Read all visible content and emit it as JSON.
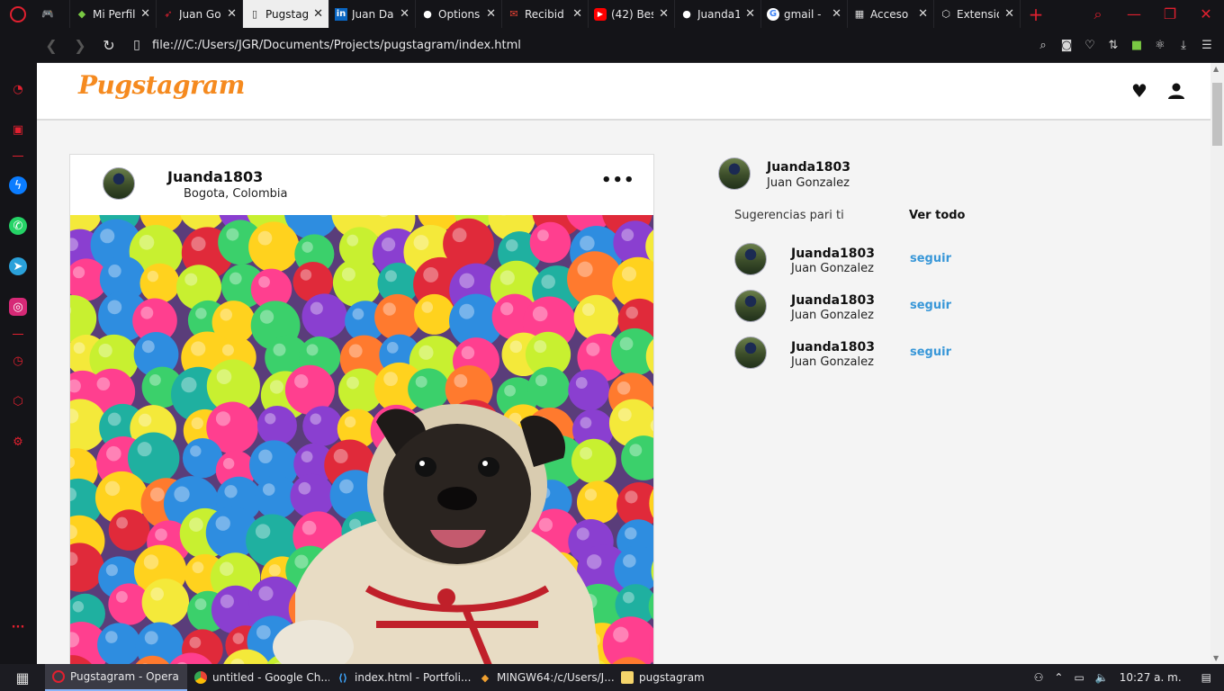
{
  "browser": {
    "tabs": [
      {
        "label": "",
        "icon": "gamepad-icon",
        "active": false
      },
      {
        "label": "Mi Perfil",
        "icon": "diamond-icon",
        "active": false
      },
      {
        "label": "Juan Go",
        "icon": "bird-icon",
        "active": false
      },
      {
        "label": "Pugstag",
        "icon": "page-icon",
        "active": true
      },
      {
        "label": "Juan Da",
        "icon": "linkedin-icon",
        "active": false
      },
      {
        "label": "Options",
        "icon": "github-icon",
        "active": false
      },
      {
        "label": "Recibid",
        "icon": "gmail-icon",
        "active": false
      },
      {
        "label": "(42) Bes",
        "icon": "youtube-icon",
        "active": false
      },
      {
        "label": "Juanda1",
        "icon": "github-icon",
        "active": false
      },
      {
        "label": "gmail -",
        "icon": "google-icon",
        "active": false
      },
      {
        "label": "Acceso",
        "icon": "apps-icon",
        "active": false
      },
      {
        "label": "Extensio",
        "icon": "cube-icon",
        "active": false
      }
    ],
    "url": "file:///C:/Users/JGR/Documents/Projects/pugstagram/index.html",
    "accent_color": "#e0202f"
  },
  "page": {
    "brand": "Pugstagram",
    "post": {
      "username": "Juanda1803",
      "location": "Bogota, Colombia",
      "more_label": "•••"
    },
    "profile": {
      "username": "Juanda1803",
      "name": "Juan Gonzalez"
    },
    "suggestions_title": "Sugerencias pari ti",
    "see_all_label": "Ver todo",
    "suggestions": [
      {
        "username": "Juanda1803",
        "name": "Juan Gonzalez",
        "follow_label": "seguir"
      },
      {
        "username": "Juanda1803",
        "name": "Juan Gonzalez",
        "follow_label": "seguir"
      },
      {
        "username": "Juanda1803",
        "name": "Juan Gonzalez",
        "follow_label": "seguir"
      }
    ],
    "link_color": "#3897d8"
  },
  "taskbar": {
    "items": [
      {
        "label": "Pugstagram - Opera",
        "icon": "opera-icon",
        "active": true
      },
      {
        "label": "untitled - Google Ch...",
        "icon": "chrome-icon",
        "active": false
      },
      {
        "label": "index.html - Portfoli...",
        "icon": "vscode-icon",
        "active": false
      },
      {
        "label": "MINGW64:/c/Users/J...",
        "icon": "git-icon",
        "active": false
      },
      {
        "label": "pugstagram",
        "icon": "folder-icon",
        "active": false
      }
    ],
    "clock": "10:27 a. m."
  }
}
